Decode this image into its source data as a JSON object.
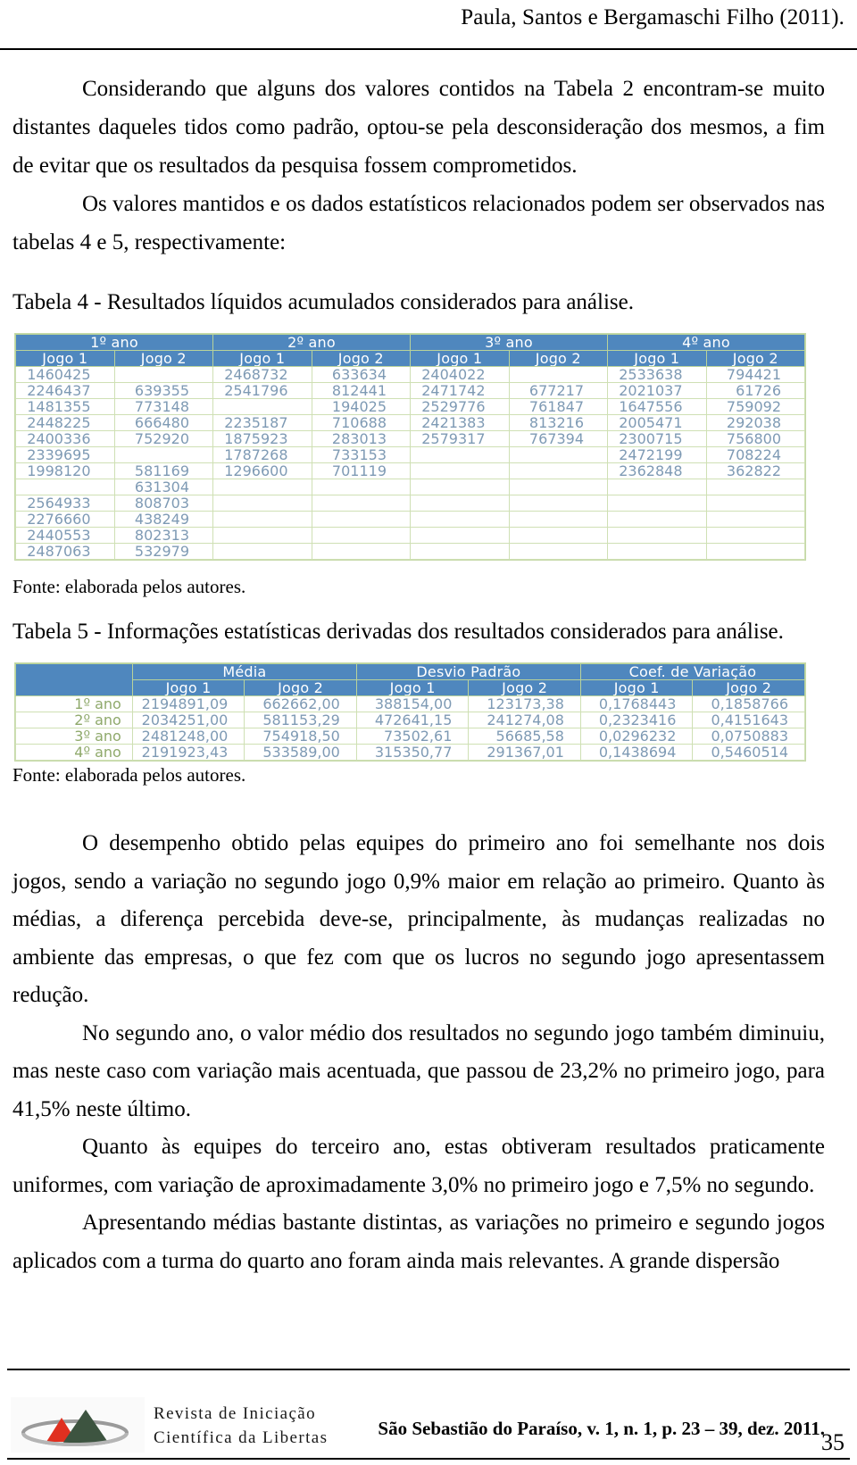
{
  "header": {
    "running_head": "Paula, Santos e Bergamaschi Filho (2011)."
  },
  "body": {
    "p1": "Considerando que alguns dos valores contidos na Tabela 2 encontram-se muito distantes daqueles tidos como padrão, optou-se pela desconsideração dos mesmos, a fim de evitar que os resultados da pesquisa fossem comprometidos.",
    "p2": "Os valores mantidos e os dados estatísticos relacionados podem ser observados nas tabelas 4 e 5, respectivamente:",
    "p3": "O desempenho obtido pelas equipes do primeiro ano foi semelhante nos dois jogos, sendo a variação no segundo jogo 0,9% maior em relação ao primeiro. Quanto às médias, a diferença percebida deve-se, principalmente, às mudanças realizadas no ambiente das empresas, o que fez com que os lucros no segundo jogo apresentassem redução.",
    "p4": "No segundo ano, o valor médio dos resultados no segundo jogo também diminuiu, mas neste caso com variação mais acentuada, que passou de 23,2% no primeiro jogo, para 41,5% neste último.",
    "p5": "Quanto às equipes do terceiro ano, estas obtiveram resultados praticamente uniformes, com variação de aproximadamente 3,0% no primeiro jogo e 7,5% no segundo.",
    "p6": "Apresentando médias bastante distintas, as variações no primeiro e segundo jogos aplicados com a turma do quarto ano foram ainda mais relevantes. A grande dispersão"
  },
  "table4": {
    "caption": "Tabela 4 - Resultados líquidos acumulados considerados para análise.",
    "source": "Fonte: elaborada pelos autores.",
    "group_headers": [
      "1º ano",
      "2º ano",
      "3º ano",
      "4º ano"
    ],
    "sub_headers": [
      "Jogo 1",
      "Jogo 2",
      "Jogo 1",
      "Jogo 2",
      "Jogo 1",
      "Jogo 2",
      "Jogo 1",
      "Jogo 2"
    ],
    "rows": [
      [
        "1460425",
        "",
        "2468732",
        "633634",
        "2404022",
        "",
        "2533638",
        "794421"
      ],
      [
        "2246437",
        "639355",
        "2541796",
        "812441",
        "2471742",
        "677217",
        "2021037",
        "61726"
      ],
      [
        "1481355",
        "773148",
        "",
        "194025",
        "2529776",
        "761847",
        "1647556",
        "759092"
      ],
      [
        "2448225",
        "666480",
        "2235187",
        "710688",
        "2421383",
        "813216",
        "2005471",
        "292038"
      ],
      [
        "2400336",
        "752920",
        "1875923",
        "283013",
        "2579317",
        "767394",
        "2300715",
        "756800"
      ],
      [
        "2339695",
        "",
        "1787268",
        "733153",
        "",
        "",
        "2472199",
        "708224"
      ],
      [
        "1998120",
        "581169",
        "1296600",
        "701119",
        "",
        "",
        "2362848",
        "362822"
      ],
      [
        "",
        "631304",
        "",
        "",
        "",
        "",
        "",
        ""
      ],
      [
        "2564933",
        "808703",
        "",
        "",
        "",
        "",
        "",
        ""
      ],
      [
        "2276660",
        "438249",
        "",
        "",
        "",
        "",
        "",
        ""
      ],
      [
        "2440553",
        "802313",
        "",
        "",
        "",
        "",
        "",
        ""
      ],
      [
        "2487063",
        "532979",
        "",
        "",
        "",
        "",
        "",
        ""
      ]
    ]
  },
  "table5": {
    "caption": "Tabela 5 - Informações estatísticas derivadas dos resultados considerados para análise.",
    "source": "Fonte: elaborada pelos autores.",
    "corner": "",
    "group_headers": [
      "Média",
      "Desvio Padrão",
      "Coef. de Variação"
    ],
    "sub_headers": [
      "Jogo 1",
      "Jogo 2",
      "Jogo 1",
      "Jogo 2",
      "Jogo 1",
      "Jogo 2"
    ],
    "rows": [
      {
        "label": "1º ano",
        "values": [
          "2194891,09",
          "662662,00",
          "388154,00",
          "123173,38",
          "0,1768443",
          "0,1858766"
        ]
      },
      {
        "label": "2º ano",
        "values": [
          "2034251,00",
          "581153,29",
          "472641,15",
          "241274,08",
          "0,2323416",
          "0,4151643"
        ]
      },
      {
        "label": "3º ano",
        "values": [
          "2481248,00",
          "754918,50",
          "73502,61",
          "56685,58",
          "0,0296232",
          "0,0750883"
        ]
      },
      {
        "label": "4º ano",
        "values": [
          "2191923,43",
          "533589,00",
          "315350,77",
          "291367,01",
          "0,1438694",
          "0,5460514"
        ]
      }
    ]
  },
  "footer": {
    "journal_line1": "Revista de Iniciação",
    "journal_line2": "Científica da Libertas",
    "issue": "São Sebastião do Paraíso, v. 1, n. 1, p. 23 – 39, dez. 2011.",
    "page_number": "35"
  },
  "colors": {
    "table_header_blue": "#4f87be",
    "table_number_blue": "#7e9ab4",
    "table_rowlabel_green": "#8fa96b",
    "table_gridline_green": "#cfe0b4",
    "logo_green": "#3d5440",
    "logo_red": "#e03020",
    "logo_gray": "#9a9a9a"
  }
}
